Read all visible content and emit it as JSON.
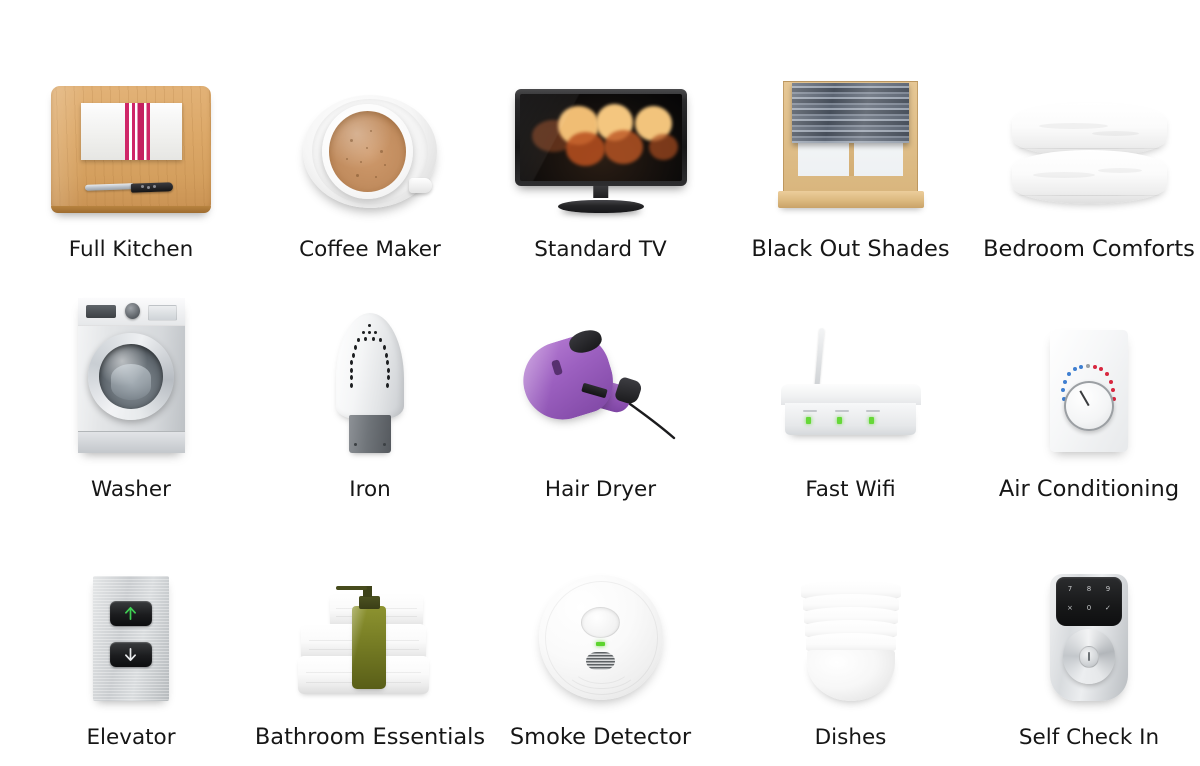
{
  "page": {
    "background_color": "#ffffff",
    "text_color": "#161616",
    "layout": {
      "columns": 5,
      "rows": 3,
      "total_items": 15
    }
  },
  "amenities": [
    {
      "id": "full-kitchen",
      "label": "Full Kitchen",
      "icon": "cutting-board-knife-towel-icon",
      "row": 1,
      "col": 1
    },
    {
      "id": "coffee-maker",
      "label": "Coffee Maker",
      "icon": "coffee-cup-saucer-icon",
      "row": 1,
      "col": 2
    },
    {
      "id": "standard-tv",
      "label": "Standard TV",
      "icon": "flatscreen-television-icon",
      "row": 1,
      "col": 3
    },
    {
      "id": "black-out-shades",
      "label": "Black Out Shades",
      "icon": "window-blinds-icon",
      "row": 1,
      "col": 4
    },
    {
      "id": "bedroom-comforts",
      "label": "Bedroom Comforts",
      "icon": "stacked-pillows-icon",
      "row": 1,
      "col": 5
    },
    {
      "id": "washer",
      "label": "Washer",
      "icon": "washing-machine-icon",
      "row": 2,
      "col": 1
    },
    {
      "id": "iron",
      "label": "Iron",
      "icon": "clothes-iron-icon",
      "row": 2,
      "col": 2
    },
    {
      "id": "hair-dryer",
      "label": "Hair Dryer",
      "icon": "hair-dryer-icon",
      "row": 2,
      "col": 3
    },
    {
      "id": "fast-wifi",
      "label": "Fast Wifi",
      "icon": "wifi-router-icon",
      "row": 2,
      "col": 4
    },
    {
      "id": "air-conditioning",
      "label": "Air Conditioning",
      "icon": "thermostat-dial-icon",
      "row": 2,
      "col": 5
    },
    {
      "id": "elevator",
      "label": "Elevator",
      "icon": "elevator-call-buttons-icon",
      "row": 3,
      "col": 1
    },
    {
      "id": "bathroom-essentials",
      "label": "Bathroom Essentials",
      "icon": "towels-soap-dispenser-icon",
      "row": 3,
      "col": 2
    },
    {
      "id": "smoke-detector",
      "label": "Smoke Detector",
      "icon": "smoke-detector-icon",
      "row": 3,
      "col": 3
    },
    {
      "id": "dishes",
      "label": "Dishes",
      "icon": "stacked-bowls-icon",
      "row": 3,
      "col": 4
    },
    {
      "id": "self-check-in",
      "label": "Self Check In",
      "icon": "smart-keypad-lock-icon",
      "row": 3,
      "col": 5
    }
  ],
  "icon_details": {
    "full_kitchen": {
      "board_color": "#d9a566",
      "towel_stripe_color": "#cf2668",
      "knife_handle_color": "#17171a"
    },
    "coffee_maker": {
      "crema_color": "#c28d5f",
      "cup_color": "#ffffff"
    },
    "standard_tv": {
      "bezel_color": "#16161a",
      "bokeh_colors": [
        "#f2c27a",
        "#e8a85e",
        "#c4632b",
        "#a64b22"
      ]
    },
    "black_out_shades": {
      "frame_color": "#ddb981",
      "shade_color": "#5b6472"
    },
    "bedroom_comforts": {
      "pillow_color": "#fbfbfb",
      "pillow_count": 2
    },
    "washer": {
      "body_color": "#dcdfe2",
      "door_glass_color": "#5e666d"
    },
    "iron": {
      "soleplate_color": "#f4f5f6",
      "heel_color": "#6f7479",
      "vent_hole_count": 27
    },
    "hair_dryer": {
      "body_color": "#9c60c0",
      "nozzle_color": "#1a1a1c"
    },
    "fast_wifi": {
      "body_color": "#f0f1f2",
      "led_color": "#66d838",
      "led_count": 3,
      "antenna_count": 1
    },
    "air_conditioning": {
      "plate_color": "#f6f7f8",
      "cold_dot_color": "#3f7fd1",
      "hot_dot_color": "#d8273f",
      "neutral_dot_color": "#9ca0a4"
    },
    "elevator": {
      "plate_color": "#ccd0d3",
      "up_arrow_color": "#3ecf52",
      "down_arrow_color": "#e8eaec",
      "buttons": [
        "up",
        "down"
      ]
    },
    "bathroom_essentials": {
      "towel_color": "#fafafa",
      "towel_count": 3,
      "soap_bottle_color": "#767c24"
    },
    "smoke_detector": {
      "body_color": "#f7f7f7",
      "led_color": "#5cd42d"
    },
    "dishes": {
      "bowl_color": "#fbfbfb",
      "bowl_count": 6
    },
    "self_check_in": {
      "keypad_color": "#171819",
      "knob_color": "#d4d8db",
      "keys": [
        "7",
        "8",
        "9",
        "×",
        "0",
        "✓"
      ]
    }
  }
}
